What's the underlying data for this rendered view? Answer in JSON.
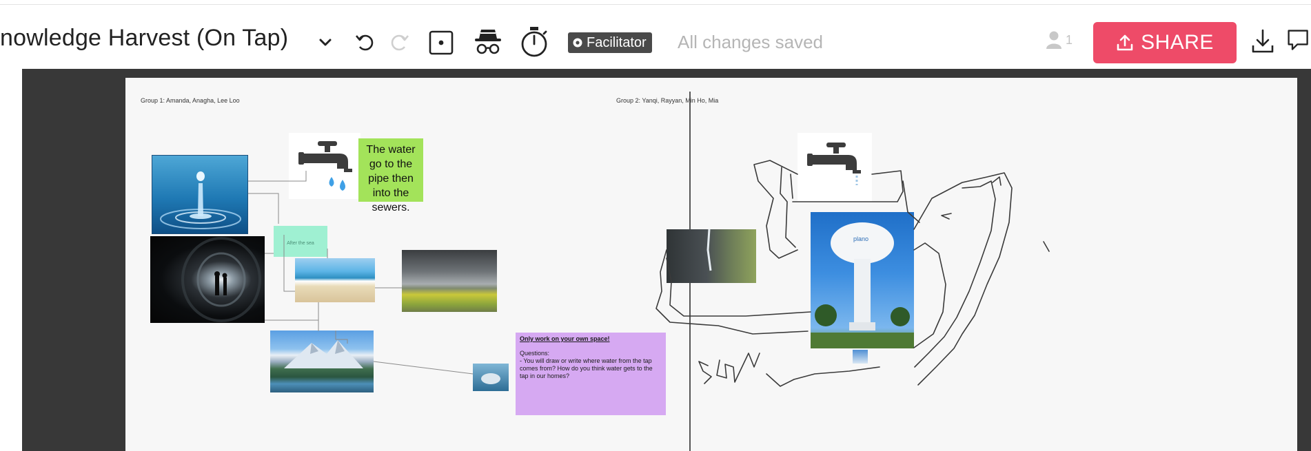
{
  "toolbar": {
    "board_title": "nowledge Harvest (On Tap)",
    "facilitator_label": "Facilitator",
    "save_status": "All changes saved",
    "user_count": "1",
    "share_label": "SHARE"
  },
  "board": {
    "group1": {
      "label": "Group 1: Amanda, Anagha, Lee Loo",
      "sticky_text": "The water go to the pipe then into the sewers.",
      "mint_note": "After the sea"
    },
    "group2": {
      "label": "Group 2: Yanqi, Rayyan, Min Ho, Mia",
      "tower_text": "plano"
    },
    "instructions": {
      "heading": "Only work on your own space!",
      "questions_label": "Questions:",
      "question_1": "- You will draw or write where water from the tap comes from? How do you think water gets to the tap in our homes?"
    }
  },
  "colors": {
    "share_bg": "#ee4b68",
    "canvas_bg": "#383838",
    "board_bg": "#f7f7f7",
    "sticky_green": "#a3e35a",
    "sticky_mint": "#9ff0d2",
    "sticky_purple": "#d6a9f2"
  },
  "icons": [
    "chevron-down-icon",
    "undo-icon",
    "redo-icon",
    "dice-icon",
    "incognito-icon",
    "timer-icon",
    "user-icon",
    "upload-icon",
    "download-icon",
    "comment-icon",
    "faucet-icon",
    "water-drops-icon"
  ]
}
